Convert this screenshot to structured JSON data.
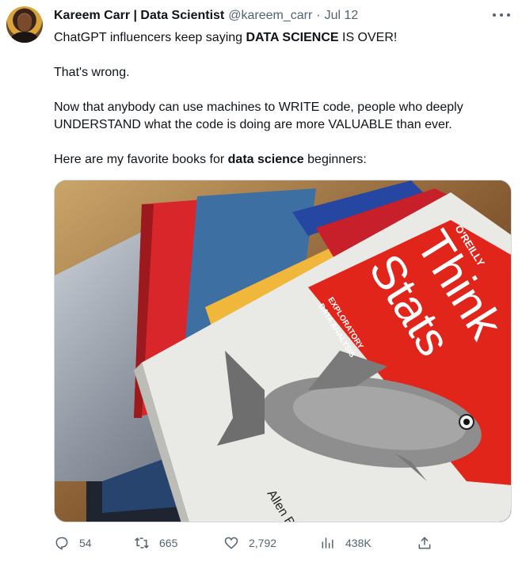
{
  "author": {
    "name": "Kareem Carr | Data Scientist",
    "handle": "@kareem_carr",
    "separator": "·",
    "date": "Jul 12"
  },
  "tweet": {
    "line1_pre": "ChatGPT influencers keep saying ",
    "line1_bold": "DATA SCIENCE",
    "line1_post": " IS OVER!",
    "line2": "That's wrong.",
    "line3": "Now that anybody can use machines to WRITE code, people who deeply UNDERSTAND what the code is doing are more VALUABLE than ever.",
    "line4_pre": "Here are my favorite books for ",
    "line4_bold": "data science",
    "line4_post": " beginners:"
  },
  "media": {
    "book_publisher": "O'REILLY",
    "book_title_1": "Think",
    "book_title_2": "Stats",
    "book_subtitle_1": "EXPLORATORY",
    "book_subtitle_2": "DATA ANALYSIS",
    "book_author": "Allen B"
  },
  "actions": {
    "replies": "54",
    "retweets": "665",
    "likes": "2,792",
    "views": "438K"
  },
  "colors": {
    "text": "#0f1419",
    "secondary": "#536471",
    "book_red": "#e1251b"
  }
}
